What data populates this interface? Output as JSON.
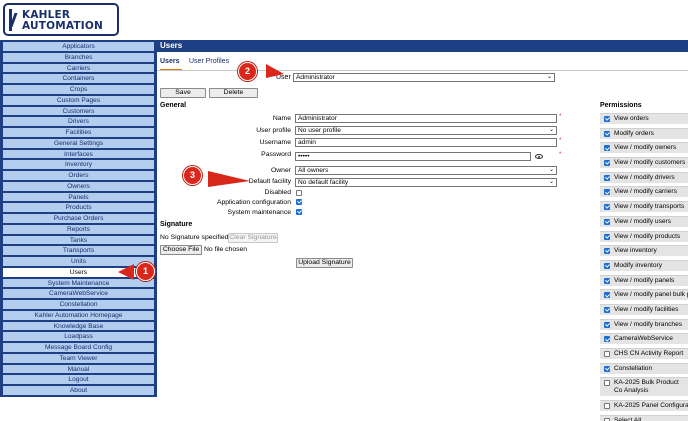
{
  "logo": {
    "line1": "KAHLER",
    "line2": "AUTOMATION"
  },
  "sidebar": {
    "items": [
      {
        "label": "Applicators"
      },
      {
        "label": "Branches"
      },
      {
        "label": "Carriers"
      },
      {
        "label": "Containers"
      },
      {
        "label": "Crops"
      },
      {
        "label": "Custom Pages"
      },
      {
        "label": "Customers"
      },
      {
        "label": "Drivers"
      },
      {
        "label": "Facilities"
      },
      {
        "label": "General Settings"
      },
      {
        "label": "Interfaces"
      },
      {
        "label": "Inventory"
      },
      {
        "label": "Orders"
      },
      {
        "label": "Owners"
      },
      {
        "label": "Panels"
      },
      {
        "label": "Products"
      },
      {
        "label": "Purchase Orders"
      },
      {
        "label": "Reports"
      },
      {
        "label": "Tanks"
      },
      {
        "label": "Transports"
      },
      {
        "label": "Units"
      },
      {
        "label": "Users",
        "active": true
      },
      {
        "label": "System Maintenance"
      },
      {
        "label": "CameraWebService"
      },
      {
        "label": "Constellation"
      },
      {
        "label": "Kahler Automation Homepage"
      },
      {
        "label": "Knowledge Base"
      },
      {
        "label": "Loadpass"
      },
      {
        "label": "Message Board Config"
      },
      {
        "label": "Team Viewer"
      },
      {
        "label": "Manual"
      },
      {
        "label": "Logout"
      },
      {
        "label": "About"
      }
    ]
  },
  "header": {
    "title": "Users"
  },
  "tabs": {
    "users": "Users",
    "profiles": "User Profiles"
  },
  "user_select": {
    "label": "User",
    "value": "Administrator"
  },
  "toolbar": {
    "save_label": "Save",
    "delete_label": "Delete"
  },
  "general": {
    "title": "General",
    "name_label": "Name",
    "name_value": "Administrator",
    "profile_label": "User profile",
    "profile_value": "No user profile",
    "username_label": "Username",
    "username_value": "admin",
    "password_label": "Password",
    "password_value": "•••••",
    "owner_label": "Owner",
    "owner_value": "All owners",
    "facility_label": "Default facility",
    "facility_value": "No default facility",
    "disabled_label": "Disabled",
    "disabled_checked": false,
    "appconfig_label": "Application configuration",
    "appconfig_checked": true,
    "sysmaint_label": "System maintenance",
    "sysmaint_checked": true,
    "required_mark": "*"
  },
  "signature": {
    "title": "Signature",
    "status": "No Signature specified",
    "clear_label": "Clear Signature",
    "choose_label": "Choose File",
    "no_file": "No file chosen",
    "upload_label": "Upload Signature"
  },
  "permissions": {
    "title": "Permissions",
    "items": [
      {
        "label": "View orders",
        "checked": true
      },
      {
        "label": "Modify orders",
        "checked": true
      },
      {
        "label": "View / modify owners",
        "checked": true
      },
      {
        "label": "View / modify customers",
        "checked": true
      },
      {
        "label": "View / modify drivers",
        "checked": true
      },
      {
        "label": "View / modify carriers",
        "checked": true
      },
      {
        "label": "View / modify transports",
        "checked": true
      },
      {
        "label": "View / modify users",
        "checked": true
      },
      {
        "label": "View / modify products",
        "checked": true
      },
      {
        "label": "View inventory",
        "checked": true
      },
      {
        "label": "Modify inventory",
        "checked": true
      },
      {
        "label": "View / modify panels",
        "checked": true
      },
      {
        "label": "View / modify panel bulk p",
        "checked": true
      },
      {
        "label": "View / modify facilities",
        "checked": true
      },
      {
        "label": "View / modify branches",
        "checked": true
      },
      {
        "label": "CameraWebService",
        "checked": true
      },
      {
        "label": "CHS CN Activity Report",
        "checked": false
      },
      {
        "label": "Constellation",
        "checked": true
      },
      {
        "label": "KA-2025 Bulk Product Co Analysis",
        "checked": false,
        "tall": true
      },
      {
        "label": "KA-2025 Panel Configura",
        "checked": false
      },
      {
        "label": "Select All",
        "checked": false
      }
    ]
  },
  "callouts": {
    "one": "1",
    "two": "2",
    "three": "3"
  },
  "colors": {
    "nav_bg": "#b3cdef",
    "nav_border": "#1f3f85",
    "header_bg": "#1f3f85",
    "callout": "#d9271c",
    "checkbox": "#1d6fd6"
  }
}
